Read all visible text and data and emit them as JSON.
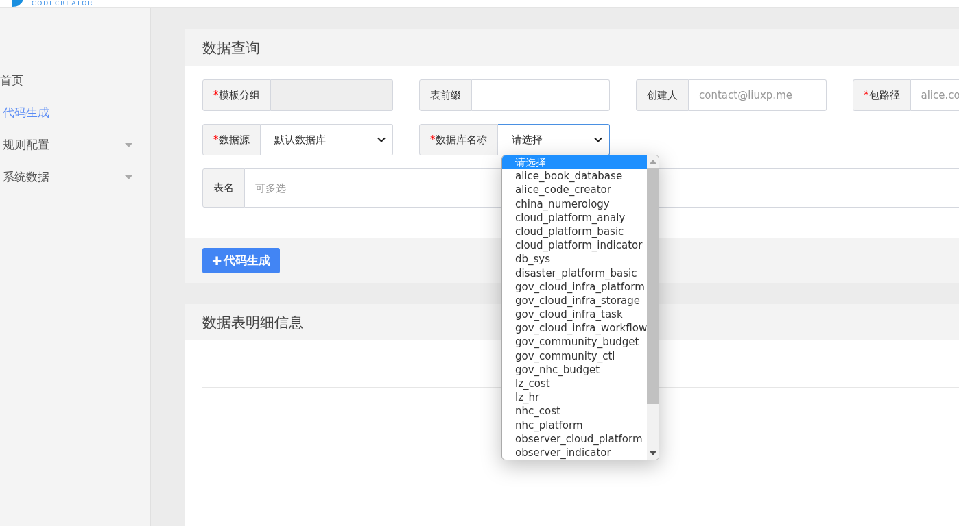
{
  "logo": {
    "text": "CODECREATOR"
  },
  "sidebar": {
    "items": [
      {
        "label": "首页",
        "selected": false,
        "expandable": false
      },
      {
        "label": "代码生成",
        "selected": true,
        "expandable": false
      },
      {
        "label": "规则配置",
        "selected": false,
        "expandable": true
      },
      {
        "label": "系统数据",
        "selected": false,
        "expandable": true
      }
    ]
  },
  "query_panel": {
    "title": "数据查询",
    "filter_rows": [
      {
        "fields": [
          {
            "label": "模板分组",
            "required_mark": "*",
            "kind": "input",
            "disabled": true
          },
          {
            "label": "表前缀",
            "kind": "input",
            "disabled": false
          },
          {
            "label": "创建人",
            "kind": "input",
            "disabled": false,
            "placeholder": "contact@liuxp.me"
          },
          {
            "label": "包路径",
            "required_mark": "*",
            "kind": "input",
            "disabled": false,
            "placeholder": "alice.co"
          }
        ]
      },
      {
        "fields": [
          {
            "label": "数据源",
            "required_mark": "*",
            "kind": "select",
            "value": "默认数据库",
            "open": false
          },
          {
            "label": "数据库名称",
            "required_mark": "*",
            "kind": "select",
            "value": "请选择",
            "open": true,
            "options": [
              {
                "label": "请选择",
                "selected": true
              },
              {
                "label": "alice_book_database",
                "selected": false
              },
              {
                "label": "alice_code_creator",
                "selected": false
              },
              {
                "label": "china_numerology",
                "selected": false
              },
              {
                "label": "cloud_platform_analy",
                "selected": false
              },
              {
                "label": "cloud_platform_basic",
                "selected": false
              },
              {
                "label": "cloud_platform_indicator",
                "selected": false
              },
              {
                "label": "db_sys",
                "selected": false
              },
              {
                "label": "disaster_platform_basic",
                "selected": false
              },
              {
                "label": "gov_cloud_infra_platform",
                "selected": false
              },
              {
                "label": "gov_cloud_infra_storage",
                "selected": false
              },
              {
                "label": "gov_cloud_infra_task",
                "selected": false
              },
              {
                "label": "gov_cloud_infra_workflow",
                "selected": false
              },
              {
                "label": "gov_community_budget",
                "selected": false
              },
              {
                "label": "gov_community_ctl",
                "selected": false
              },
              {
                "label": "gov_nhc_budget",
                "selected": false
              },
              {
                "label": "lz_cost",
                "selected": false
              },
              {
                "label": "lz_hr",
                "selected": false
              },
              {
                "label": "nhc_cost",
                "selected": false
              },
              {
                "label": "nhc_platform",
                "selected": false
              },
              {
                "label": "observer_cloud_platform",
                "selected": false
              },
              {
                "label": "observer_indicator",
                "selected": false
              }
            ]
          }
        ]
      },
      {
        "fields": [
          {
            "label": "表名",
            "kind": "wide",
            "placeholder": "可多选"
          }
        ]
      }
    ],
    "action": {
      "icon": "✚",
      "label": "代码生成"
    }
  },
  "detail_panel": {
    "title": "数据表明细信息"
  }
}
